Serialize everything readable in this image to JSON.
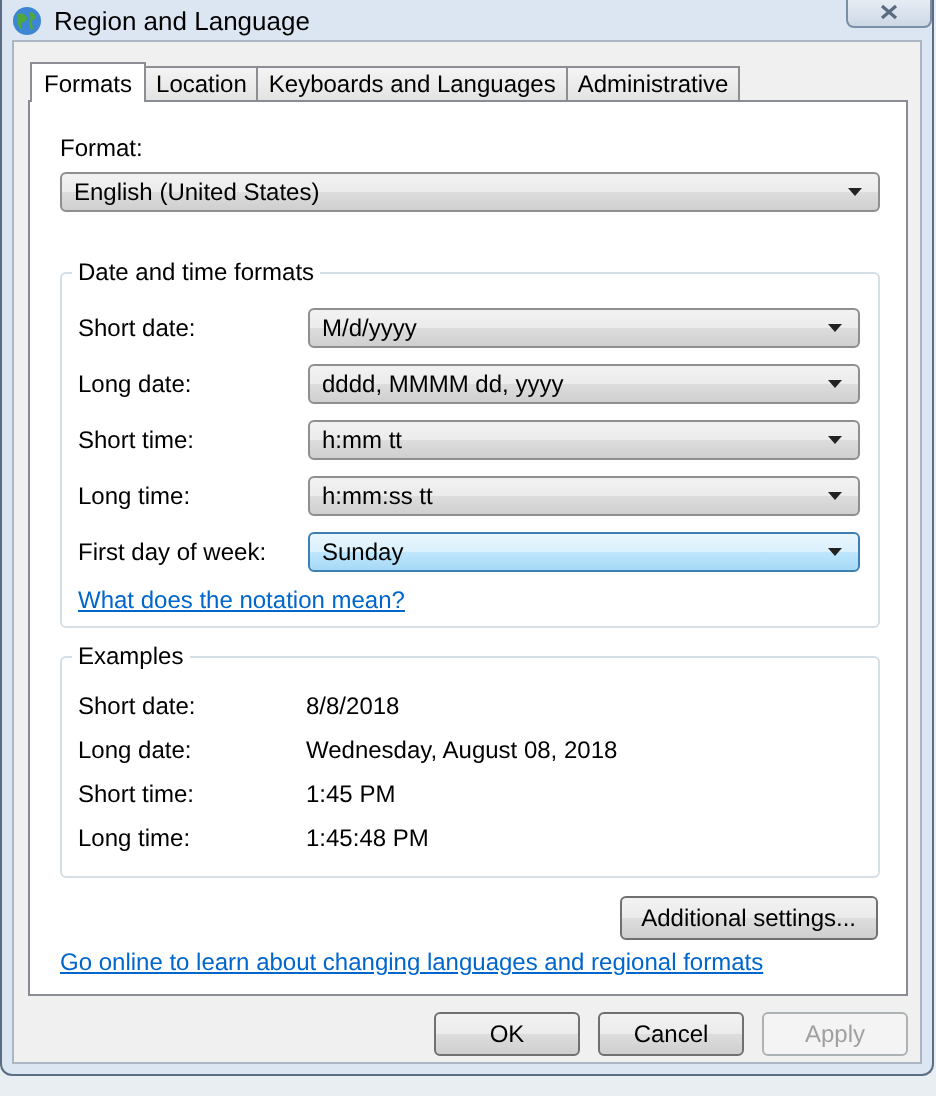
{
  "window": {
    "title": "Region and Language"
  },
  "tabs": [
    {
      "label": "Formats",
      "selected": true
    },
    {
      "label": "Location",
      "selected": false
    },
    {
      "label": "Keyboards and Languages",
      "selected": false
    },
    {
      "label": "Administrative",
      "selected": false
    }
  ],
  "format": {
    "label": "Format:",
    "value": "English (United States)"
  },
  "date_time_formats": {
    "title": "Date and time formats",
    "rows": [
      {
        "label": "Short date:",
        "value": "M/d/yyyy",
        "focused": false
      },
      {
        "label": "Long date:",
        "value": "dddd, MMMM dd, yyyy",
        "focused": false
      },
      {
        "label": "Short time:",
        "value": "h:mm tt",
        "focused": false
      },
      {
        "label": "Long time:",
        "value": "h:mm:ss tt",
        "focused": false
      },
      {
        "label": "First day of week:",
        "value": "Sunday",
        "focused": true
      }
    ],
    "help_link": "What does the notation mean?"
  },
  "examples": {
    "title": "Examples",
    "rows": [
      {
        "label": "Short date:",
        "value": "8/8/2018"
      },
      {
        "label": "Long date:",
        "value": "Wednesday, August 08, 2018"
      },
      {
        "label": "Short time:",
        "value": "1:45 PM"
      },
      {
        "label": "Long time:",
        "value": "1:45:48 PM"
      }
    ]
  },
  "additional_settings_button": "Additional settings...",
  "online_link": "Go online to learn about changing languages and regional formats",
  "buttons": [
    {
      "label": "OK",
      "disabled": false
    },
    {
      "label": "Cancel",
      "disabled": false
    },
    {
      "label": "Apply",
      "disabled": true
    }
  ]
}
